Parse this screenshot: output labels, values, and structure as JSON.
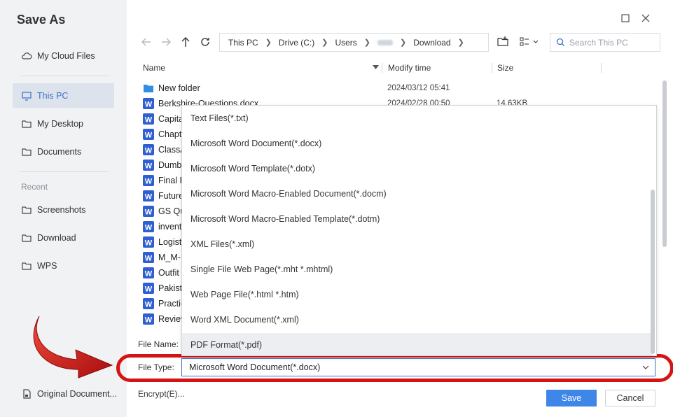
{
  "dialog": {
    "title": "Save As"
  },
  "sidebar": {
    "items": [
      {
        "label": "My Cloud Files",
        "icon": "cloud-icon"
      },
      {
        "label": "This PC",
        "icon": "monitor-icon"
      },
      {
        "label": "My Desktop",
        "icon": "folder-icon"
      },
      {
        "label": "Documents",
        "icon": "folder-icon"
      }
    ],
    "recent_header": "Recent",
    "recent": [
      {
        "label": "Screenshots",
        "icon": "folder-icon"
      },
      {
        "label": "Download",
        "icon": "folder-icon"
      },
      {
        "label": "WPS",
        "icon": "folder-icon"
      }
    ],
    "original_document": "Original Document..."
  },
  "breadcrumb": [
    "This PC",
    "Drive (C:)",
    "Users",
    "Download"
  ],
  "search": {
    "placeholder": "Search This PC"
  },
  "columns": {
    "name": "Name",
    "modify": "Modify time",
    "size": "Size"
  },
  "files": [
    {
      "name": "New folder",
      "type": "folder",
      "date": "2024/03/12 05:41",
      "size": ""
    },
    {
      "name": "Berkshire-Questions.docx",
      "type": "word",
      "date": "2024/02/28 00:50",
      "size": "14.63KB"
    },
    {
      "name": "Capita",
      "type": "word",
      "date": "",
      "size": ""
    },
    {
      "name": "Chapt",
      "type": "word",
      "date": "",
      "size": ""
    },
    {
      "name": "ClassA",
      "type": "word",
      "date": "",
      "size": ""
    },
    {
      "name": "Dumb",
      "type": "word",
      "date": "",
      "size": ""
    },
    {
      "name": "Final R",
      "type": "word",
      "date": "",
      "size": ""
    },
    {
      "name": "Future",
      "type": "word",
      "date": "",
      "size": ""
    },
    {
      "name": "GS Qu",
      "type": "word",
      "date": "",
      "size": ""
    },
    {
      "name": "invent",
      "type": "word",
      "date": "",
      "size": ""
    },
    {
      "name": "Logist",
      "type": "word",
      "date": "",
      "size": ""
    },
    {
      "name": "M_M-",
      "type": "word",
      "date": "",
      "size": ""
    },
    {
      "name": "Outfit",
      "type": "word",
      "date": "",
      "size": ""
    },
    {
      "name": "Pakista",
      "type": "word",
      "date": "",
      "size": ""
    },
    {
      "name": "Practic",
      "type": "word",
      "date": "",
      "size": ""
    },
    {
      "name": "Review",
      "type": "word",
      "date": "",
      "size": ""
    }
  ],
  "file_types": [
    "Text Files(*.txt)",
    "Microsoft Word Document(*.docx)",
    "Microsoft Word Template(*.dotx)",
    "Microsoft Word Macro-Enabled Document(*.docm)",
    "Microsoft Word Macro-Enabled Template(*.dotm)",
    "XML Files(*.xml)",
    "Single File Web Page(*.mht *.mhtml)",
    "Web Page File(*.html *.htm)",
    "Word XML Document(*.xml)",
    "PDF Format(*.pdf)"
  ],
  "highlighted_file_type": "PDF Format(*.pdf)",
  "form": {
    "file_name_label": "File Name:",
    "file_type_label": "File Type:",
    "file_type_value": "Microsoft Word Document(*.docx)",
    "encrypt_label": "Encrypt(E)..."
  },
  "buttons": {
    "save": "Save",
    "cancel": "Cancel"
  },
  "colors": {
    "accent": "#3e86e8",
    "annotation": "#d41414",
    "word_icon": "#2f5fd0",
    "folder": "#2f8de4"
  }
}
